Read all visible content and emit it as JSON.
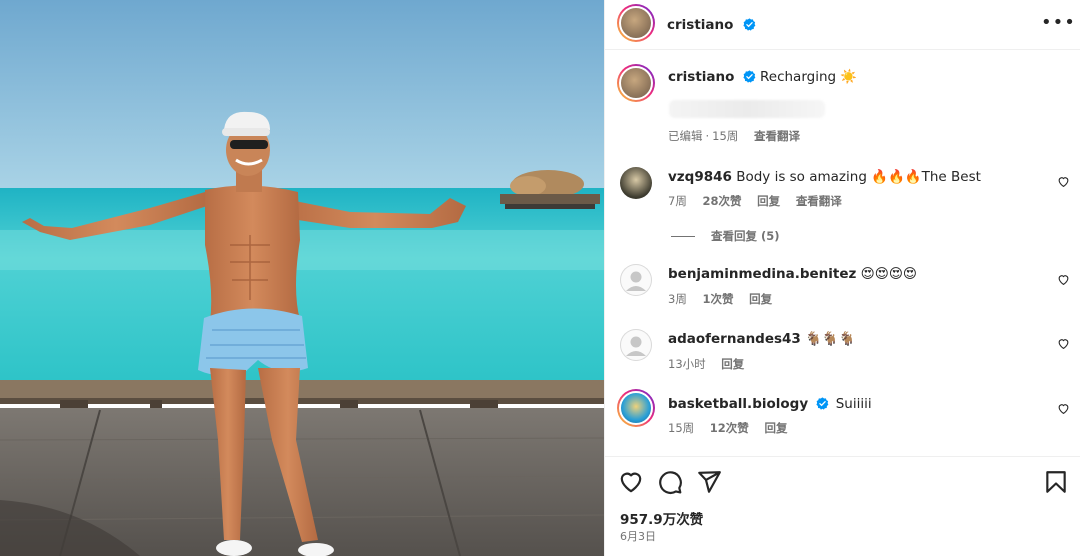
{
  "post": {
    "author": "cristiano",
    "caption_user": "cristiano",
    "caption_text": "Recharging ☀️",
    "edited_label": "已编辑",
    "age": "15周",
    "translate_label": "查看翻译"
  },
  "comments": [
    {
      "user": "vzq9846",
      "text": "Body is so amazing 🔥🔥🔥The Best",
      "age": "7周",
      "likes": "28次赞",
      "reply_label": "回复",
      "translate_label": "查看翻译",
      "verified": false
    },
    {
      "user": "benjaminmedina.benitez",
      "text": "😍😍😍😍",
      "age": "3周",
      "likes": "1次赞",
      "reply_label": "回复",
      "verified": false
    },
    {
      "user": "adaofernandes43",
      "text": "🐐🐐🐐",
      "age": "13小时",
      "likes": "",
      "reply_label": "回复",
      "verified": false
    },
    {
      "user": "basketball.biology",
      "text": "Suiiiii",
      "age": "15周",
      "likes": "12次赞",
      "reply_label": "回复",
      "verified": true
    }
  ],
  "view_replies_label": "查看回复 (5)",
  "likes_count": "957.9万次赞",
  "post_date": "6月3日",
  "icons": {
    "like": "heart-icon",
    "comment": "comment-icon",
    "share": "share-icon",
    "save": "bookmark-icon",
    "more": "more-options-icon",
    "verified": "verified-badge-icon"
  },
  "colors": {
    "verified_blue": "#0095f6",
    "meta_gray": "#737373",
    "text": "#262626"
  }
}
